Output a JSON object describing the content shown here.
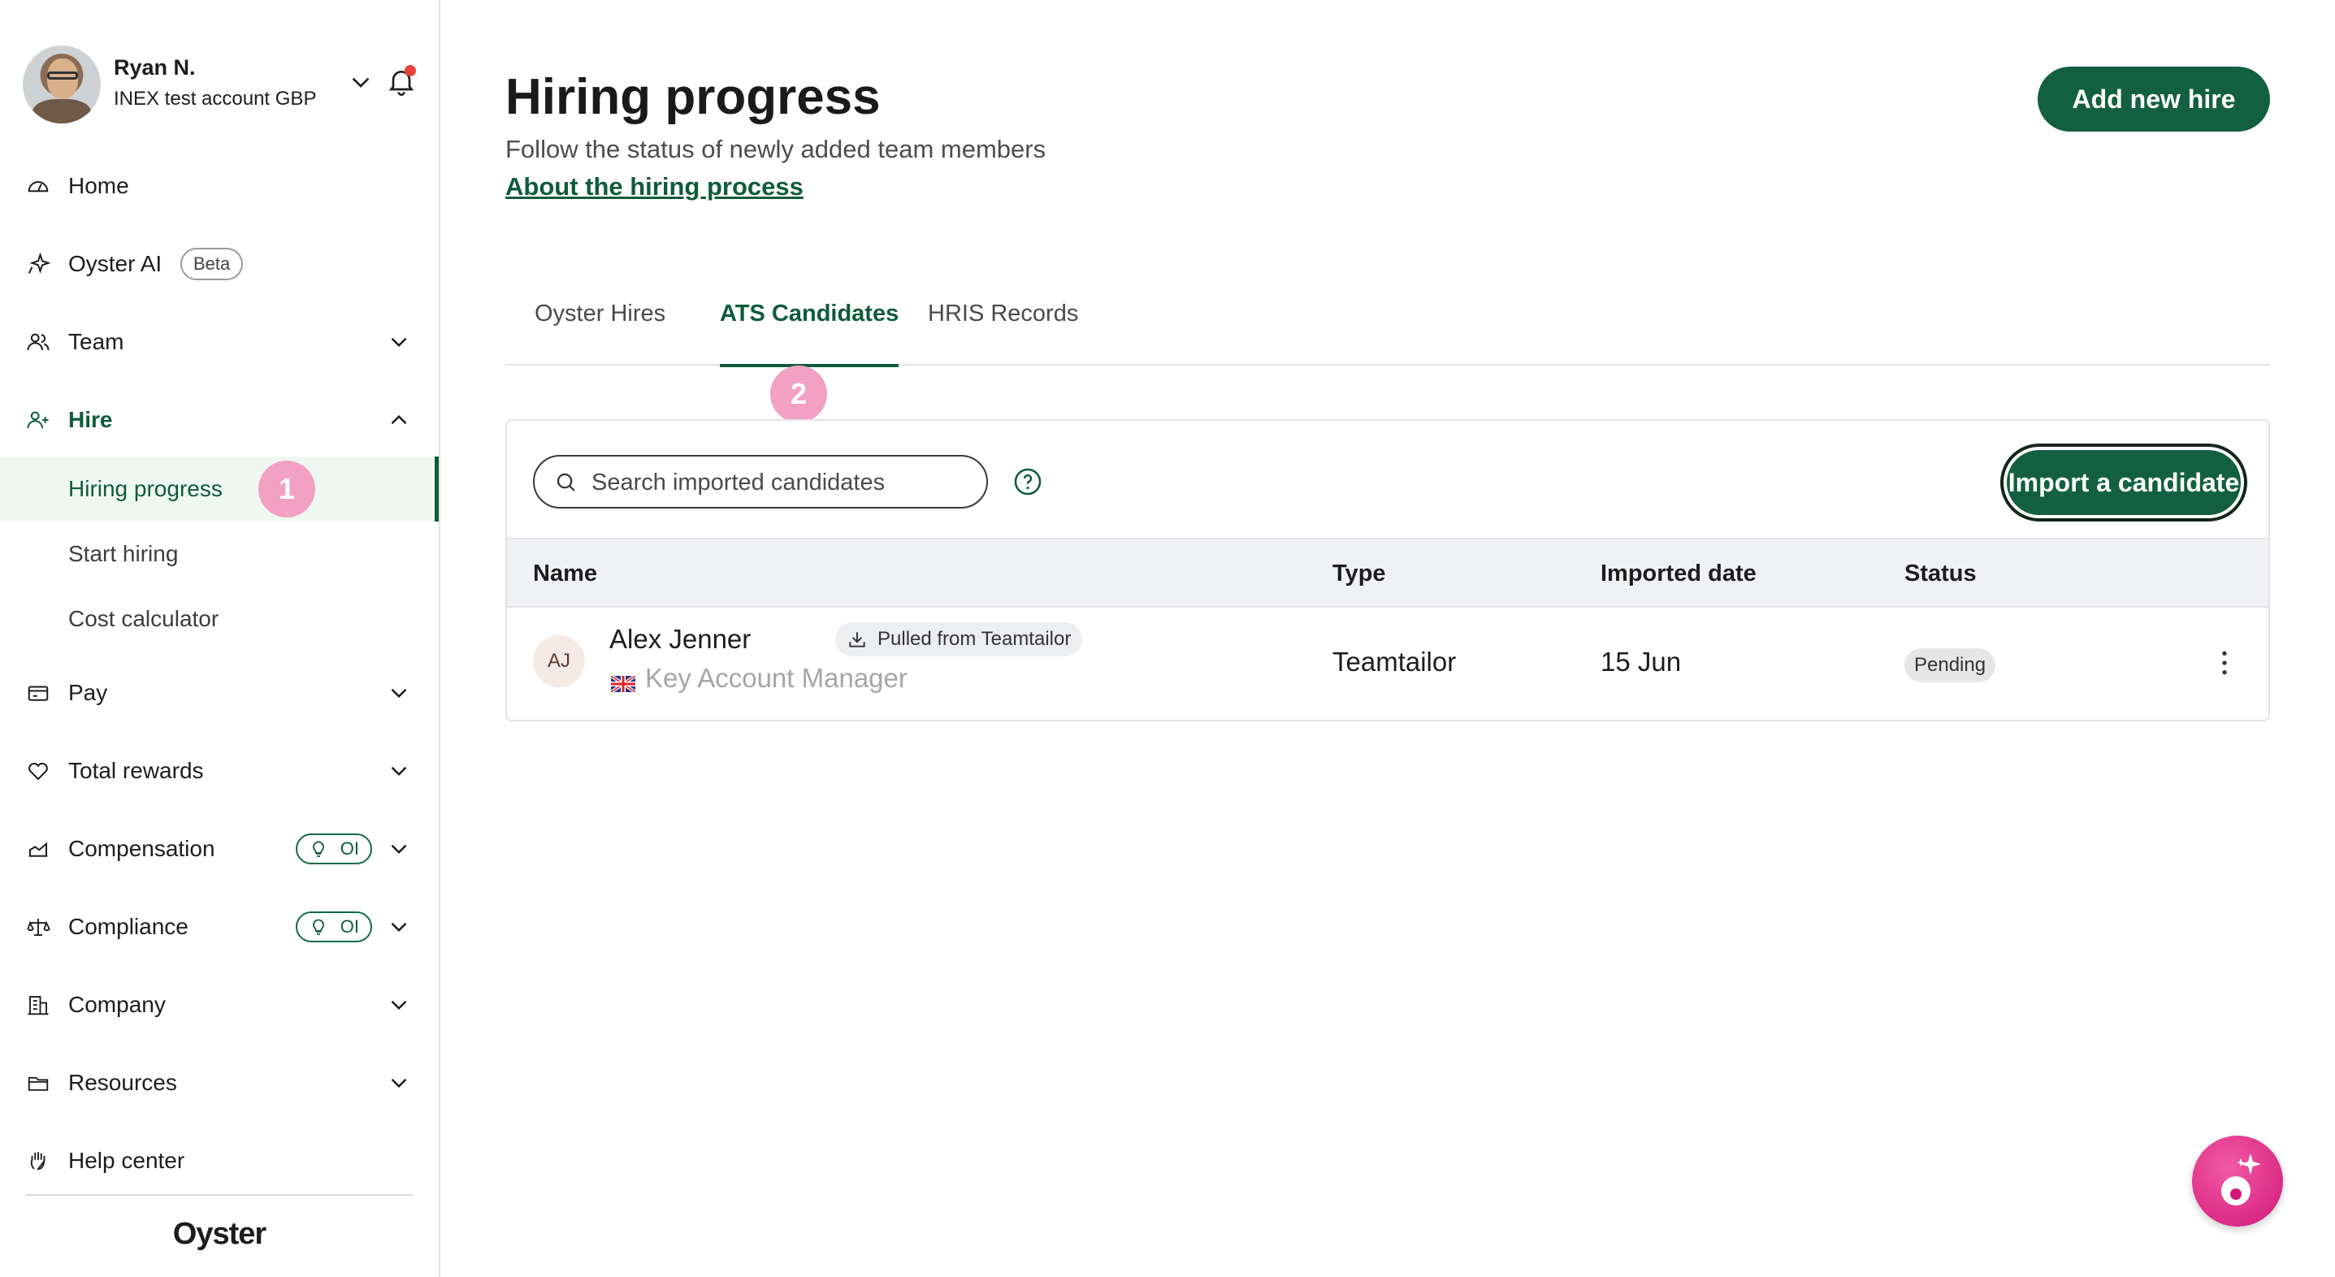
{
  "colors": {
    "brand_green": "#12603f",
    "accent_pink": "#f2a1c2",
    "fab_pink": "#d0187a"
  },
  "profile": {
    "name": "Ryan N.",
    "account": "INEX test account GBP"
  },
  "sidebar": {
    "items": [
      {
        "label": "Home",
        "icon": "home-gauge-icon"
      },
      {
        "label": "Oyster AI",
        "badge": "Beta",
        "icon": "sparkle-icon"
      },
      {
        "label": "Team",
        "icon": "team-icon"
      },
      {
        "label": "Hire",
        "icon": "add-person-icon"
      },
      {
        "label": "Pay",
        "icon": "wallet-icon"
      },
      {
        "label": "Total rewards",
        "icon": "heart-icon"
      },
      {
        "label": "Compensation",
        "badge": "OI",
        "icon": "compensation-icon"
      },
      {
        "label": "Compliance",
        "badge": "OI",
        "icon": "scale-icon"
      },
      {
        "label": "Company",
        "icon": "building-icon"
      },
      {
        "label": "Resources",
        "icon": "folder-icon"
      },
      {
        "label": "Help center",
        "icon": "hand-icon"
      }
    ],
    "hire_sub": [
      {
        "label": "Hiring progress"
      },
      {
        "label": "Start hiring"
      },
      {
        "label": "Cost calculator"
      }
    ],
    "step_markers": [
      "1",
      "2"
    ],
    "logo": "Oyster"
  },
  "header": {
    "title": "Hiring progress",
    "subtitle": "Follow the status of newly added team members",
    "link": "About the hiring process",
    "add_button": "Add new hire"
  },
  "tabs": [
    {
      "label": "Oyster Hires"
    },
    {
      "label": "ATS Candidates"
    },
    {
      "label": "HRIS Records"
    }
  ],
  "search": {
    "placeholder": "Search imported candidates"
  },
  "import_button": "Import a candidate",
  "table": {
    "columns": [
      "Name",
      "Type",
      "Imported date",
      "Status"
    ],
    "rows": [
      {
        "initials": "AJ",
        "name": "Alex Jenner",
        "source_badge": "Pulled from Teamtailor",
        "role": "Key Account Manager",
        "type": "Teamtailor",
        "imported_date": "15 Jun",
        "status": "Pending"
      }
    ]
  }
}
